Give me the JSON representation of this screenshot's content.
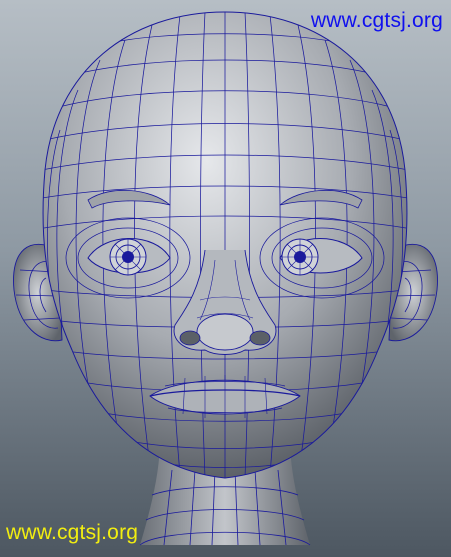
{
  "viewport": {
    "subject": "head-wireframe-model",
    "colors": {
      "background_top": "#b6bec5",
      "background_bottom": "#4d5761",
      "wireframe": "#1a1a9c",
      "shaded_surface": "#bfc2c7"
    }
  },
  "watermarks": {
    "top_right": {
      "text": "www.cgtsj.org",
      "color": "#1010ee"
    },
    "bottom_left": {
      "text": "www.cgtsj.org",
      "color": "#f2ee10"
    }
  }
}
